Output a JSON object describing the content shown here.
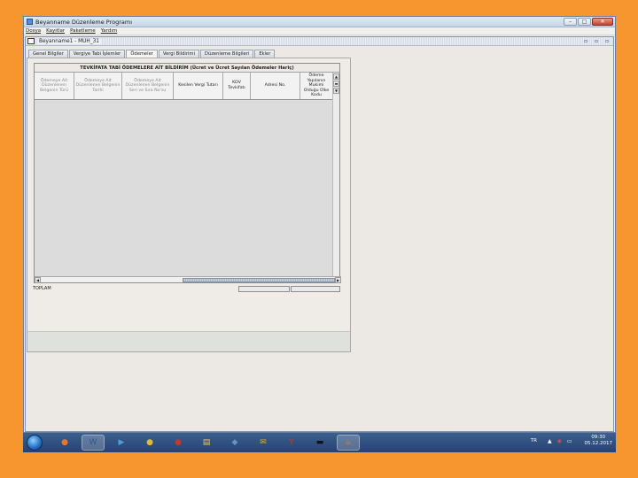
{
  "window": {
    "title": "Beyanname Düzenleme Programı",
    "controls": {
      "minimize": "–",
      "maximize": "□",
      "close": "✕"
    }
  },
  "menu": [
    "Dosya",
    "Kayıtlar",
    "Paketleme",
    "Yardım"
  ],
  "document": {
    "title": "Beyanname1 - MUH_31",
    "controls": [
      "▫",
      "▫",
      "▫"
    ]
  },
  "tabs": [
    {
      "label": "Genel Bilgiler",
      "active": false
    },
    {
      "label": "Vergiye Tabi İşlemler",
      "active": false
    },
    {
      "label": "Ödemeler",
      "active": true
    },
    {
      "label": "Vergi Bildirimi",
      "active": false
    },
    {
      "label": "Düzenleme Bilgileri",
      "active": false
    },
    {
      "label": "Ekler",
      "active": false
    }
  ],
  "table": {
    "title": "TEVKİFATA TABİ ÖDEMELERE AİT BİLDİRİM (Ücret ve Ücret Sayılan Ödemeler Hariç)",
    "columns": [
      {
        "label": "Ödemeye Ait Düzenlenen Belgenin Türü",
        "dim": true
      },
      {
        "label": "Ödemeye Ait Düzenlenen Belgenin Tarihi",
        "dim": true
      },
      {
        "label": "Ödemeye Ait Düzenlenen Belgenin Seri ve Sıra No'su",
        "dim": true
      },
      {
        "label": "Kesilen Vergi Tutarı",
        "dim": false
      },
      {
        "label": "KDV Tevkifatı",
        "dim": false
      },
      {
        "label": "Adresi No.",
        "dim": false
      },
      {
        "label": "Ödeme Yapılanın Mukimi Olduğu Ülke Kodu",
        "dim": false
      }
    ],
    "total_label": "TOPLAM"
  },
  "taskbar": {
    "items": [
      {
        "icon": "firefox-icon",
        "glyph": "●",
        "color": "#e8772e"
      },
      {
        "icon": "word-icon",
        "glyph": "W",
        "color": "#2b5797"
      },
      {
        "icon": "media-player-icon",
        "glyph": "▶",
        "color": "#4aa1d8"
      },
      {
        "icon": "chrome-icon",
        "glyph": "●",
        "color": "#e0b93a"
      },
      {
        "icon": "browser-icon",
        "glyph": "●",
        "color": "#c0392b"
      },
      {
        "icon": "folder-icon",
        "glyph": "▤",
        "color": "#e6c46a"
      },
      {
        "icon": "app-icon",
        "glyph": "◆",
        "color": "#6d8fc9"
      },
      {
        "icon": "mail-icon",
        "glyph": "✉",
        "color": "#e8a33c"
      },
      {
        "icon": "yandex-icon",
        "glyph": "Y",
        "color": "#d93025"
      },
      {
        "icon": "terminal-icon",
        "glyph": "▬",
        "color": "#111111"
      },
      {
        "icon": "java-icon",
        "glyph": "☕",
        "color": "#e07a2e"
      }
    ],
    "lang": "TR",
    "time": "09:30",
    "date": "05.12.2017"
  }
}
